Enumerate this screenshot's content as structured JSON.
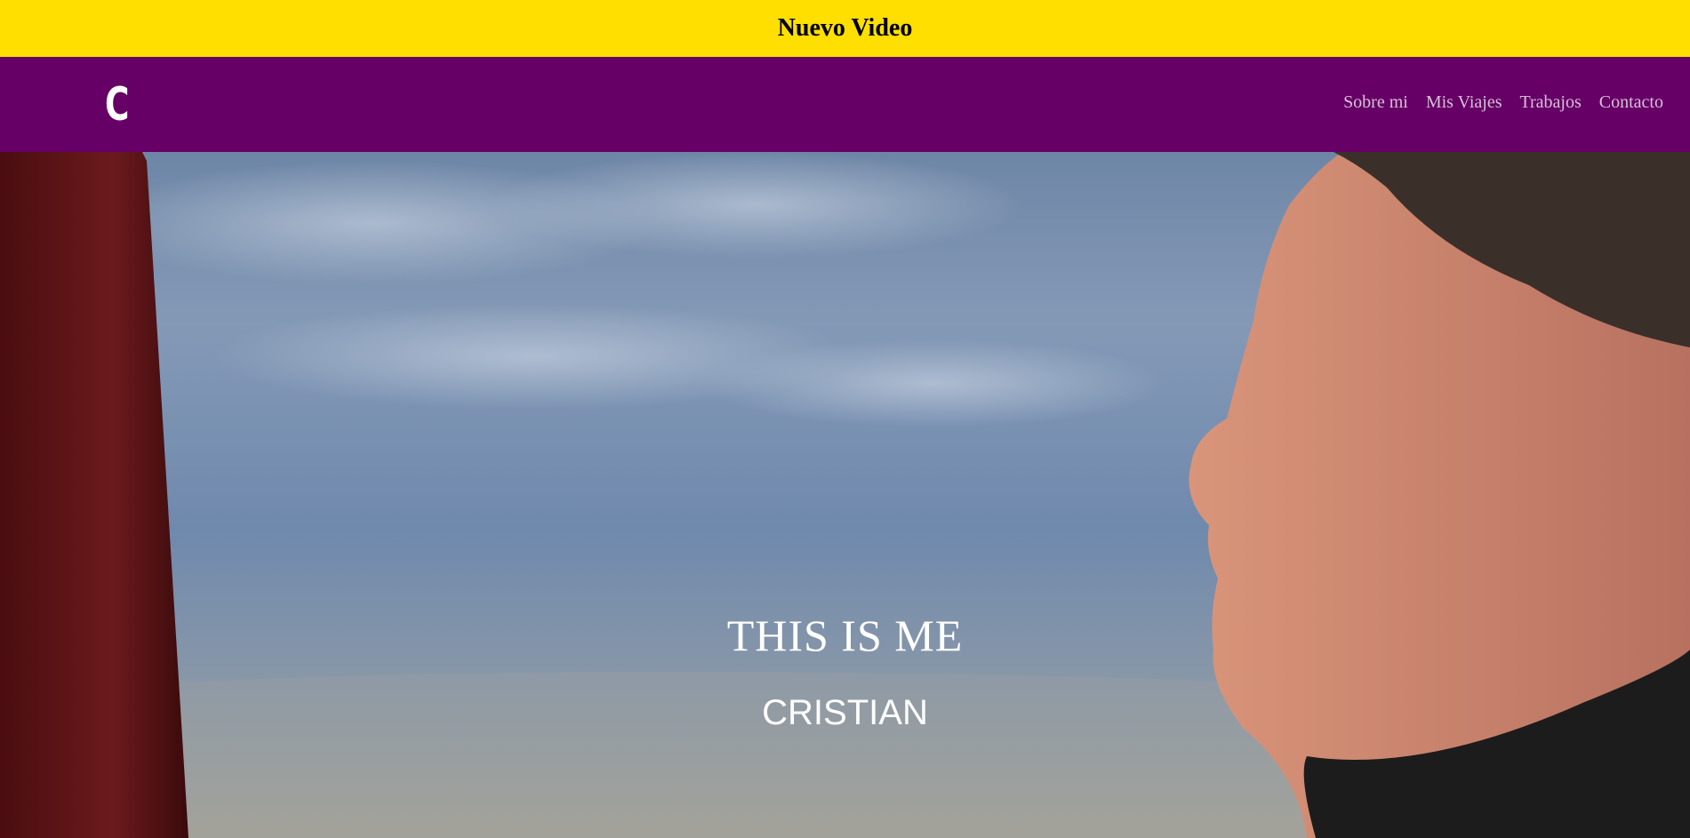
{
  "announcement": {
    "label": "Nuevo Video"
  },
  "navbar": {
    "logo": "C",
    "links": [
      "Sobre mi",
      "Mis Viajes",
      "Trabajos",
      "Contacto"
    ]
  },
  "hero": {
    "title": "THIS IS ME",
    "subtitle": "CRISTIAN",
    "background": "photo-sky-balloon-portrait"
  },
  "colors": {
    "announcement_bg": "#ffdf00",
    "navbar_bg": "#660066",
    "nav_link": "#d7bfd7"
  }
}
